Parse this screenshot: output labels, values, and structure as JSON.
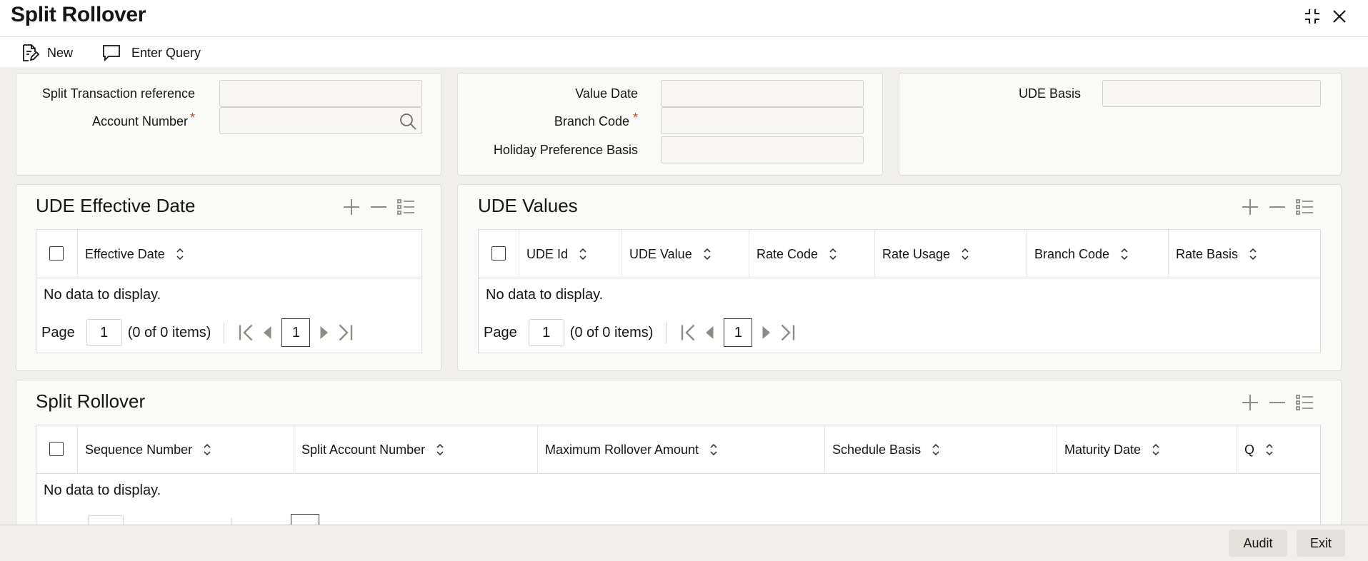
{
  "window": {
    "title": "Split Rollover"
  },
  "toolbar": {
    "new_label": "New",
    "enter_query_label": "Enter Query"
  },
  "header_form": {
    "split_txn_ref_label": "Split Transaction reference",
    "account_number_label": "Account Number",
    "value_date_label": "Value Date",
    "branch_code_label": "Branch Code",
    "holiday_pref_label": "Holiday Preference Basis",
    "ude_basis_label": "UDE Basis",
    "required_marker": "*"
  },
  "ude_effective": {
    "title": "UDE Effective Date",
    "columns": [
      "Effective Date"
    ],
    "no_data": "No data to display.",
    "page_label": "Page",
    "page_value": "1",
    "items_text": "(0 of 0 items)",
    "current_page": "1"
  },
  "ude_values": {
    "title": "UDE Values",
    "columns": [
      "UDE Id",
      "UDE Value",
      "Rate Code",
      "Rate Usage",
      "Branch Code",
      "Rate Basis"
    ],
    "no_data": "No data to display.",
    "page_label": "Page",
    "page_value": "1",
    "items_text": "(0 of 0 items)",
    "current_page": "1"
  },
  "split_rollover": {
    "title": "Split Rollover",
    "columns": [
      "Sequence Number",
      "Split Account Number",
      "Maximum Rollover Amount",
      "Schedule Basis",
      "Maturity Date",
      "Q"
    ],
    "no_data": "No data to display."
  },
  "footer": {
    "audit_label": "Audit",
    "exit_label": "Exit"
  }
}
